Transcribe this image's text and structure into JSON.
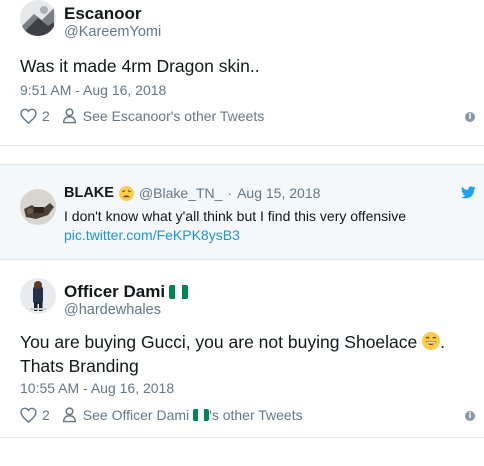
{
  "tweet1": {
    "name": "Escanoor",
    "handle": "@KareemYomi",
    "text": "Was it made 4rm Dragon skin..",
    "timestamp": "9:51 AM - Aug 16, 2018",
    "likes": "2",
    "other_tweets": "See Escanoor's other Tweets"
  },
  "quoted": {
    "name": "BLAKE",
    "handle": "@Blake_TN_",
    "separator": "·",
    "date": "Aug 15, 2018",
    "text": "I don't know what y'all think but I find this very offensive",
    "link": "pic.twitter.com/FeKPK8ysB3"
  },
  "tweet2": {
    "name": "Officer Dami",
    "handle": "@hardewhales",
    "text_part1": "You are buying Gucci, you are not buying Shoelace",
    "text_part2": ". Thats Branding",
    "timestamp": "10:55 AM - Aug 16, 2018",
    "likes": "2",
    "other_tweets_prefix": "See Officer Dami",
    "other_tweets_suffix": "'s other Tweets"
  },
  "icons": {
    "like": "heart-icon",
    "profile": "person-icon",
    "info": "info-icon",
    "bird": "twitter-bird-icon",
    "flag": "nigeria-flag-icon"
  },
  "colors": {
    "text": "#14171a",
    "secondary": "#657786",
    "link": "#1b95e0",
    "twitter_blue": "#1da1f2",
    "flag_green": "#008751"
  }
}
